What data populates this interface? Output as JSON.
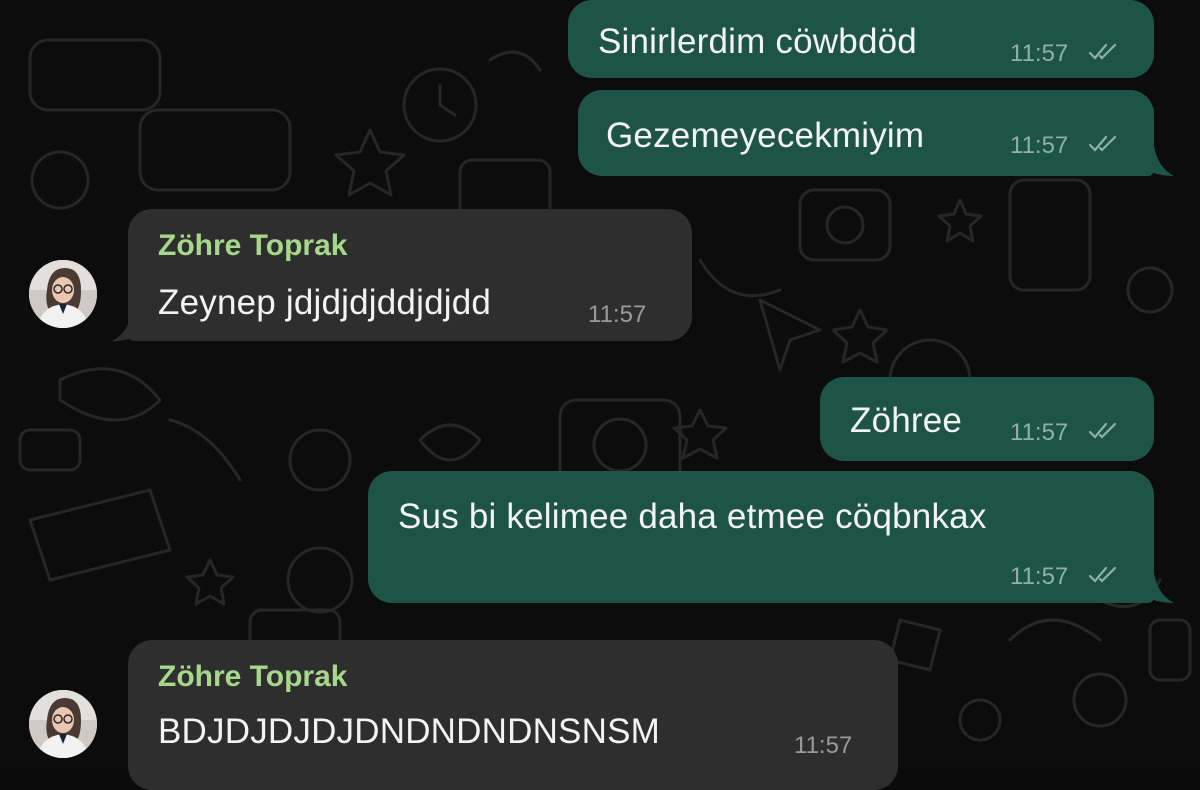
{
  "chat": {
    "messages": [
      {
        "direction": "outgoing",
        "text": "Sinirlerdim cöwbdöd",
        "time": "11:57",
        "status_icon": "double-check-icon"
      },
      {
        "direction": "outgoing",
        "text": "Gezemeyecekmiyim",
        "time": "11:57",
        "status_icon": "double-check-icon"
      },
      {
        "direction": "incoming",
        "sender": "Zöhre Toprak",
        "text": "Zeynep jdjdjdjddjdjdd",
        "time": "11:57",
        "avatar_icon": "profile-photo"
      },
      {
        "direction": "outgoing",
        "text": "Zöhree",
        "time": "11:57",
        "status_icon": "double-check-icon"
      },
      {
        "direction": "outgoing",
        "text": "Sus bi kelimee daha etmee cöqbnkax",
        "time": "11:57",
        "status_icon": "double-check-icon"
      },
      {
        "direction": "incoming",
        "sender": "Zöhre Toprak",
        "text": "BDJDJDJDJDNDNDNDNSNSM",
        "time": "11:57",
        "avatar_icon": "profile-photo"
      }
    ]
  },
  "colors": {
    "background": "#0c0c0c",
    "outgoing_bubble": "#1e5446",
    "incoming_bubble": "#2e2e2e",
    "sender_name": "#a6d78b"
  }
}
